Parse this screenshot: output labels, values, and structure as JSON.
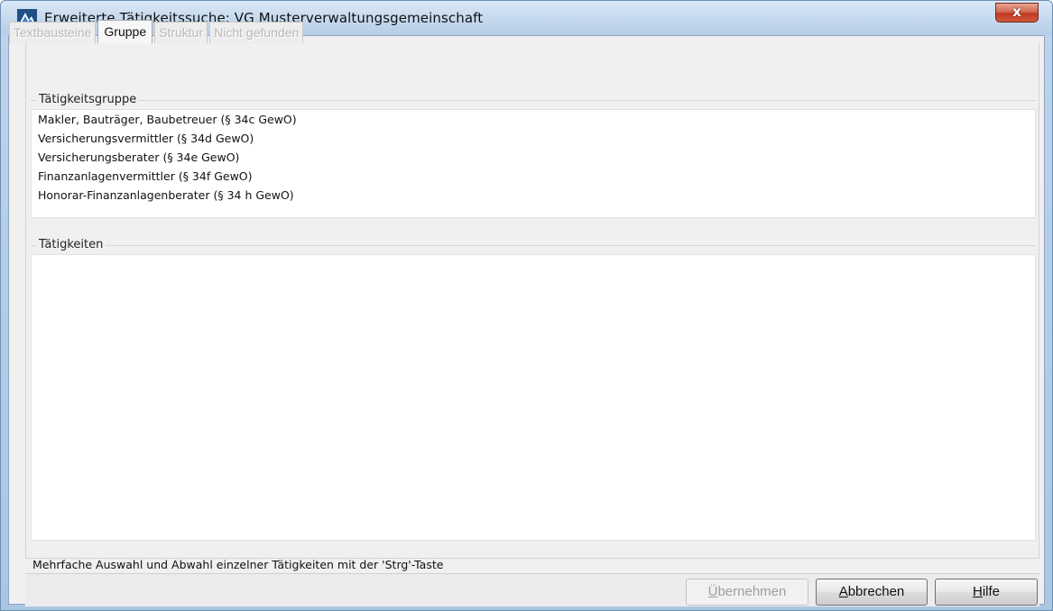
{
  "window": {
    "title": "Erweiterte Tätigkeitssuche: VG Musterverwaltungsgemeinschaft",
    "close_label": "x"
  },
  "tabs": [
    {
      "label": "Textbausteine",
      "active": false,
      "enabled": false
    },
    {
      "label": "Gruppe",
      "active": true,
      "enabled": true
    },
    {
      "label": "Struktur",
      "active": false,
      "enabled": false
    },
    {
      "label": "Nicht gefunden",
      "active": false,
      "enabled": false
    }
  ],
  "group_section": {
    "label": "Tätigkeitsgruppe",
    "items": [
      "Makler, Bauträger, Baubetreuer (§ 34c GewO)",
      "Versicherungsvermittler (§ 34d GewO)",
      "Versicherungsberater (§ 34e GewO)",
      "Finanzanlagenvermittler (§ 34f GewO)",
      "Honorar-Finanzanlagenberater (§ 34 h GewO)"
    ]
  },
  "activities_section": {
    "label": "Tätigkeiten",
    "items": []
  },
  "hint": "Mehrfache Auswahl und Abwahl einzelner Tätigkeiten mit der 'Strg'-Taste",
  "buttons": {
    "apply": {
      "mnemonic": "Ü",
      "rest": "bernehmen",
      "enabled": false
    },
    "cancel": {
      "mnemonic": "A",
      "rest": "bbrechen",
      "enabled": true
    },
    "help": {
      "mnemonic": "H",
      "rest": "ilfe",
      "enabled": true
    }
  },
  "colors": {
    "titlebar": "#c8dbef",
    "client_bg": "#f0f0f0",
    "close_red": "#c2391f",
    "disabled_text": "#b8b8b8"
  }
}
